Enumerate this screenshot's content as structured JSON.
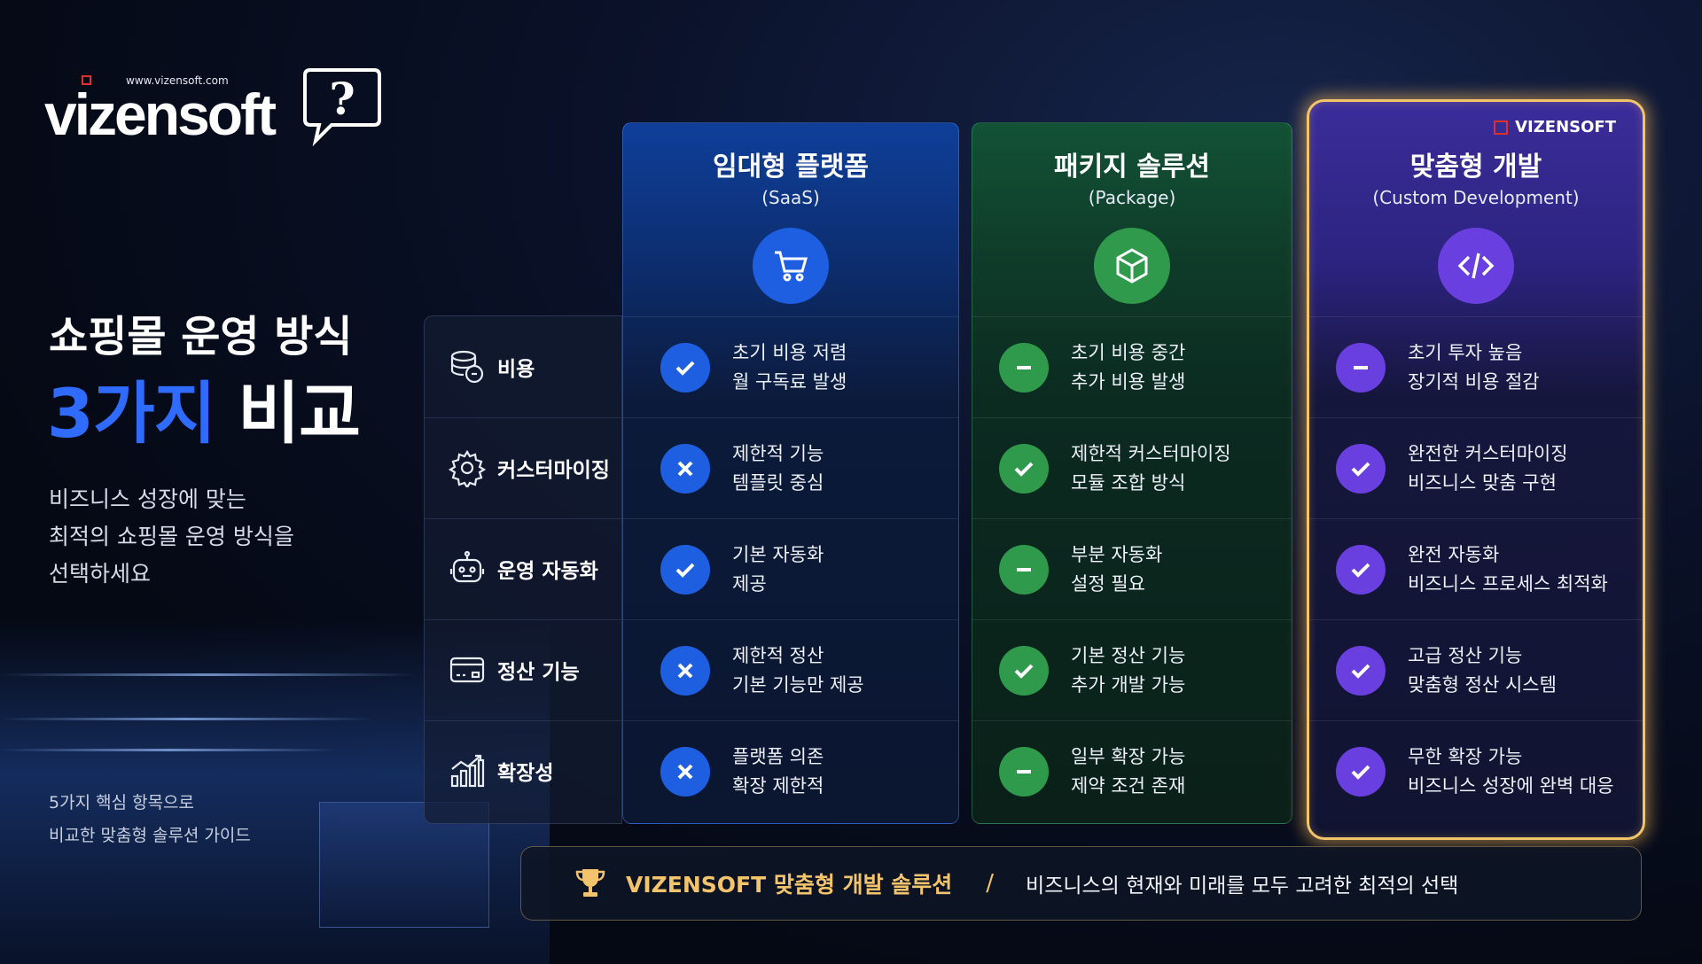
{
  "brand": {
    "url": "www.vizensoft.com",
    "wordmark": "vizensoft",
    "badge": "VIZENSOFT"
  },
  "hero": {
    "line1": "쇼핑몰 운영 방식",
    "line2_accent": "3가지",
    "line2_rest": "비교",
    "description": [
      "비즈니스 성장에 맞는",
      "최적의 쇼핑몰 운영 방식을",
      "선택하세요"
    ],
    "footnote": [
      "5가지 핵심 항목으로",
      "비교한 맞춤형 솔루션 가이드"
    ]
  },
  "rows": [
    {
      "label": "비용",
      "icon": "coins-icon"
    },
    {
      "label": "커스터마이징",
      "icon": "gear-icon"
    },
    {
      "label": "운영 자동화",
      "icon": "robot-icon"
    },
    {
      "label": "정산 기능",
      "icon": "card-icon"
    },
    {
      "label": "확장성",
      "icon": "growth-chart-icon"
    }
  ],
  "columns": [
    {
      "title": "임대형 플랫폼",
      "subtitle": "(SaaS)",
      "icon": "cart-icon",
      "accent": "#1d5fe0",
      "cells": [
        {
          "status": "check",
          "lines": [
            "초기 비용 저렴",
            "월 구독료 발생"
          ]
        },
        {
          "status": "cross",
          "lines": [
            "제한적 기능",
            "템플릿 중심"
          ]
        },
        {
          "status": "check",
          "lines": [
            "기본 자동화",
            "제공"
          ]
        },
        {
          "status": "cross",
          "lines": [
            "제한적 정산",
            "기본 기능만 제공"
          ]
        },
        {
          "status": "cross",
          "lines": [
            "플랫폼 의존",
            "확장 제한적"
          ]
        }
      ]
    },
    {
      "title": "패키지 솔루션",
      "subtitle": "(Package)",
      "icon": "box-icon",
      "accent": "#2f9a4c",
      "cells": [
        {
          "status": "minus",
          "lines": [
            "초기 비용 중간",
            "추가 비용 발생"
          ]
        },
        {
          "status": "check",
          "lines": [
            "제한적 커스터마이징",
            "모듈 조합 방식"
          ]
        },
        {
          "status": "minus",
          "lines": [
            "부분 자동화",
            "설정 필요"
          ]
        },
        {
          "status": "check",
          "lines": [
            "기본 정산 기능",
            "추가 개발 가능"
          ]
        },
        {
          "status": "minus",
          "lines": [
            "일부 확장 가능",
            "제약 조건 존재"
          ]
        }
      ]
    },
    {
      "title": "맞춤형 개발",
      "subtitle": "(Custom Development)",
      "icon": "code-icon",
      "accent": "#6a3fe0",
      "cells": [
        {
          "status": "minus",
          "lines": [
            "초기 투자 높음",
            "장기적 비용 절감"
          ]
        },
        {
          "status": "check",
          "lines": [
            "완전한 커스터마이징",
            "비즈니스 맞춤 구현"
          ]
        },
        {
          "status": "check",
          "lines": [
            "완전 자동화",
            "비즈니스 프로세스 최적화"
          ]
        },
        {
          "status": "check",
          "lines": [
            "고급 정산 기능",
            "맞춤형 정산 시스템"
          ]
        },
        {
          "status": "check",
          "lines": [
            "무한 확장 가능",
            "비즈니스 성장에 완벽 대응"
          ]
        }
      ]
    }
  ],
  "banner": {
    "brand": "VIZENSOFT 맞춤형 개발 솔루션",
    "separator": "/",
    "tagline": "비즈니스의 현재와 미래를 모두 고려한 최적의 선택"
  },
  "colors": {
    "highlight_border": "#f2c56b",
    "accent_blue": "#2f6bff",
    "banner_gold": "#f3c46c"
  }
}
